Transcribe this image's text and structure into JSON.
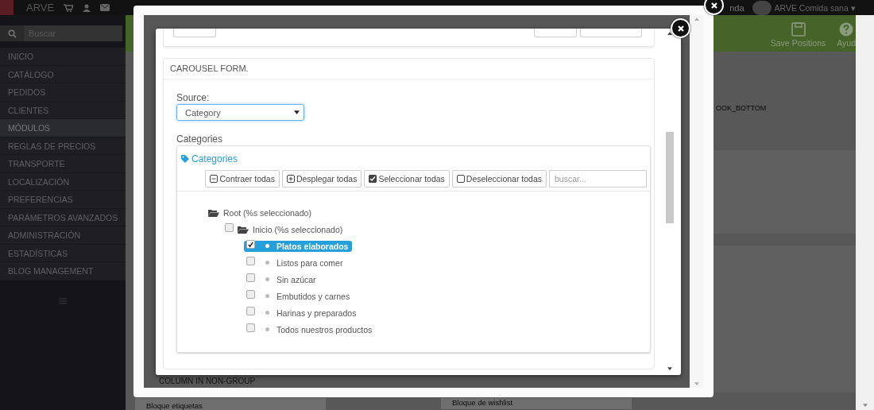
{
  "topbar": {
    "brand": "ARVE",
    "shop_link": "nda",
    "user": "ARVE Comida sana ▾"
  },
  "sidebar": {
    "search": {
      "placeholder": "Buscar"
    },
    "items": [
      {
        "label": "INICIO",
        "selected": false
      },
      {
        "label": "CATÁLOGO",
        "selected": false
      },
      {
        "label": "PEDIDOS",
        "selected": false
      },
      {
        "label": "CLIENTES",
        "selected": false
      },
      {
        "label": "MÓDULOS",
        "selected": true
      },
      {
        "label": "REGLAS DE PRECIOS",
        "selected": false
      },
      {
        "label": "TRANSPORTE",
        "selected": false
      },
      {
        "label": "LOCALIZACIÓN",
        "selected": false
      },
      {
        "label": "PREFERENCIAS",
        "selected": false
      },
      {
        "label": "PARÁMETROS AVANZADOS",
        "selected": false
      },
      {
        "label": "ADMINISTRACIÓN",
        "selected": false
      },
      {
        "label": "ESTADÍSTICAS",
        "selected": false
      },
      {
        "label": "BLOG MANAGEMENT",
        "selected": false
      }
    ]
  },
  "toolbar": {
    "buttons": [
      {
        "kind": "save",
        "label": "Save Positions"
      },
      {
        "kind": "help",
        "label": "Ayud"
      }
    ]
  },
  "content": {
    "hook_label": "OOK_BOTTOM",
    "section_label": "COLUMN IN NON-GROUP",
    "modules": [
      "Bloque etiquetas",
      "Bloque de wishlist"
    ]
  },
  "form": {
    "title": "CAROUSEL FORM.",
    "source_label": "Source:",
    "source_value": "Category",
    "categories_label": "Categories",
    "tree": {
      "title": "Categories",
      "buttons": [
        {
          "kind": "collapse",
          "label": "Contraer todas"
        },
        {
          "kind": "expand",
          "label": "Desplegar todas"
        },
        {
          "kind": "check",
          "label": "Seleccionar todas"
        },
        {
          "kind": "uncheck",
          "label": "Deseleccionar todas"
        }
      ],
      "search": {
        "placeholder": "buscar..."
      },
      "nodes": [
        {
          "kind": "folder",
          "label": "Root (%s seleccionado)",
          "children": [
            {
              "kind": "folder",
              "label": "Inicio (%s seleccionado)",
              "checked": false,
              "children": [
                {
                  "kind": "leaf",
                  "label": "Platos elaborados",
                  "checked": true
                },
                {
                  "kind": "leaf",
                  "label": "Listos para comer",
                  "checked": false
                },
                {
                  "kind": "leaf",
                  "label": "Sin azúcar",
                  "checked": false
                },
                {
                  "kind": "leaf",
                  "label": "Embutidos y carnes",
                  "checked": false
                },
                {
                  "kind": "leaf",
                  "label": "Harinas y preparados",
                  "checked": false
                },
                {
                  "kind": "leaf",
                  "label": "Todos nuestros productos",
                  "checked": false
                }
              ]
            }
          ]
        }
      ]
    }
  }
}
